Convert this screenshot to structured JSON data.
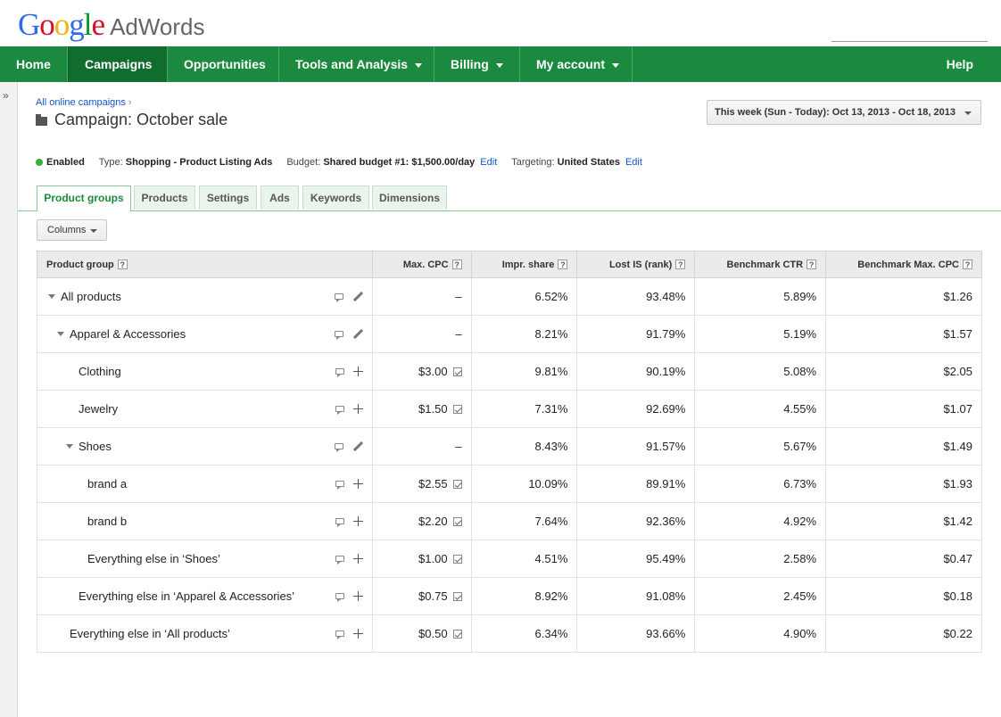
{
  "header": {
    "logo_letters": [
      "G",
      "o",
      "o",
      "g",
      "l",
      "e"
    ],
    "product": "AdWords"
  },
  "nav": {
    "home": "Home",
    "campaigns": "Campaigns",
    "opportunities": "Opportunities",
    "tools": "Tools and Analysis",
    "billing": "Billing",
    "account": "My account",
    "help": "Help"
  },
  "breadcrumb": {
    "parent": "All online campaigns",
    "separator": "›"
  },
  "campaign": {
    "label": "Campaign:",
    "name": "October sale"
  },
  "date_range": "This week (Sun - Today): Oct 13, 2013 - Oct 18, 2013",
  "status": {
    "state": "Enabled",
    "type_label": "Type:",
    "type_value": "Shopping - Product Listing Ads",
    "budget_label": "Budget:",
    "budget_value": "Shared budget #1: $1,500.00/day",
    "edit": "Edit",
    "targeting_label": "Targeting:",
    "targeting_value": "United States",
    "colors": {
      "enabled_dot": "#3aaa3a",
      "nav_green": "#1c8a3e",
      "link": "#1155cc"
    }
  },
  "tabs": [
    "Product groups",
    "Products",
    "Settings",
    "Ads",
    "Keywords",
    "Dimensions"
  ],
  "columns_button": "Columns",
  "table": {
    "headers": [
      "Product group",
      "Max. CPC",
      "Impr. share",
      "Lost IS (rank)",
      "Benchmark CTR",
      "Benchmark Max. CPC"
    ],
    "help_glyph": "?",
    "rows": [
      {
        "name": "All products",
        "cpc": "–",
        "impr": "6.52%",
        "lost": "93.48%",
        "ctr": "5.89%",
        "bcpc": "$1.26"
      },
      {
        "name": "Apparel & Accessories",
        "cpc": "–",
        "impr": "8.21%",
        "lost": "91.79%",
        "ctr": "5.19%",
        "bcpc": "$1.57"
      },
      {
        "name": "Clothing",
        "cpc": "$3.00",
        "impr": "9.81%",
        "lost": "90.19%",
        "ctr": "5.08%",
        "bcpc": "$2.05"
      },
      {
        "name": "Jewelry",
        "cpc": "$1.50",
        "impr": "7.31%",
        "lost": "92.69%",
        "ctr": "4.55%",
        "bcpc": "$1.07"
      },
      {
        "name": "Shoes",
        "cpc": "–",
        "impr": "8.43%",
        "lost": "91.57%",
        "ctr": "5.67%",
        "bcpc": "$1.49"
      },
      {
        "name": "brand a",
        "cpc": "$2.55",
        "impr": "10.09%",
        "lost": "89.91%",
        "ctr": "6.73%",
        "bcpc": "$1.93"
      },
      {
        "name": "brand b",
        "cpc": "$2.20",
        "impr": "7.64%",
        "lost": "92.36%",
        "ctr": "4.92%",
        "bcpc": "$1.42"
      },
      {
        "name": "Everything else in ‘Shoes’",
        "cpc": "$1.00",
        "impr": "4.51%",
        "lost": "95.49%",
        "ctr": "2.58%",
        "bcpc": "$0.47"
      },
      {
        "name": "Everything else in ‘Apparel & Accessories’",
        "cpc": "$0.75",
        "impr": "8.92%",
        "lost": "91.08%",
        "ctr": "2.45%",
        "bcpc": "$0.18"
      },
      {
        "name": "Everything else in ‘All products’",
        "cpc": "$0.50",
        "impr": "6.34%",
        "lost": "93.66%",
        "ctr": "4.90%",
        "bcpc": "$0.22"
      }
    ]
  }
}
